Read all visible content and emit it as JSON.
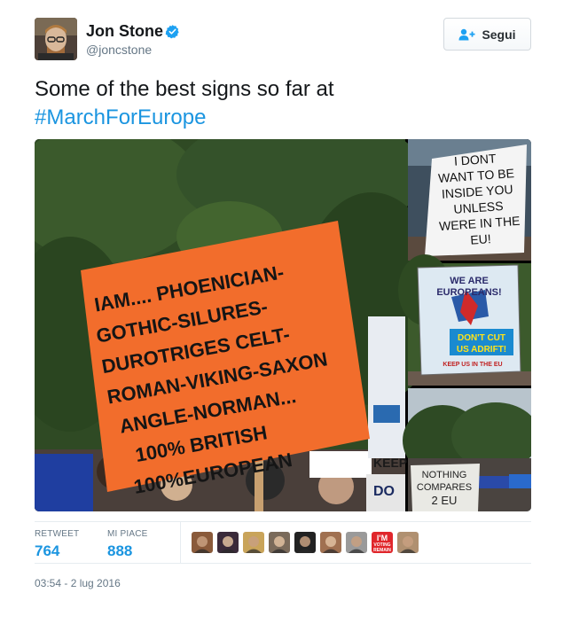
{
  "author": {
    "name": "Jon Stone",
    "handle": "@joncstone",
    "verified_icon": "verified-badge-icon"
  },
  "follow_button": {
    "label": "Segui",
    "icon": "add-user-icon"
  },
  "tweet": {
    "text": "Some of the best signs so far at",
    "hashtag": "#MarchForEurope"
  },
  "media": {
    "main_sign": [
      "IAM.... PHOENICIAN-",
      "GOTHIC-SILURES-",
      "DUROTRIGES CELT-",
      "ROMAN-VIKING-SAXON",
      "ANGLE-NORMAN...",
      "100% BRITISH",
      "100%EUROPEAN"
    ],
    "sign_top_right": [
      "I DONT",
      "WANT TO BE",
      "INSIDE YOU",
      "UNLESS",
      "WERE IN THE",
      "EU!"
    ],
    "sign_mid_right_top": [
      "WE ARE",
      "EUROPEANS!"
    ],
    "sign_mid_right_bottom": [
      "DON'T CUT",
      "US ADRIFT!",
      "KEEP US IN THE EU"
    ],
    "sign_bottom_right": [
      "NOTHING",
      "COMPARES",
      "2 EU"
    ],
    "partial_sign_1": "KEEP",
    "partial_sign_2": "DO"
  },
  "stats": {
    "retweets_label": "RETWEET",
    "retweets": "764",
    "likes_label": "MI PIACE",
    "likes": "888"
  },
  "likers": [
    {
      "name": "liker-avatar-1",
      "color": "#8a5a3a"
    },
    {
      "name": "liker-avatar-2",
      "color": "#3a2a3a"
    },
    {
      "name": "liker-avatar-3",
      "color": "#c9a45a"
    },
    {
      "name": "liker-avatar-4",
      "color": "#7a6a5a"
    },
    {
      "name": "liker-avatar-5",
      "color": "#222222"
    },
    {
      "name": "liker-avatar-6",
      "color": "#a07050"
    },
    {
      "name": "liker-avatar-7",
      "color": "#9a9a9a"
    },
    {
      "name": "liker-avatar-8",
      "color": "#e0262b",
      "text": [
        "I'M",
        "VOTING",
        "REMAIN"
      ]
    },
    {
      "name": "liker-avatar-9",
      "color": "#b09070"
    }
  ],
  "timestamp": "03:54 - 2 lug 2016",
  "colors": {
    "link": "#1b95e0",
    "sign_orange": "#f26d2c",
    "secondary_text": "#657786"
  }
}
